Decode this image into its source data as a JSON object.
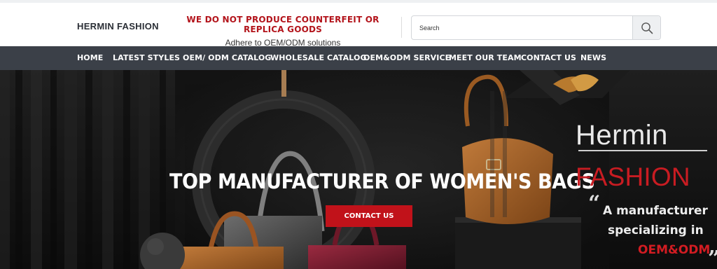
{
  "header": {
    "brand": "HERMIN FASHION",
    "notice_title": "WE DO NOT PRODUCE COUNTERFEIT OR REPLICA GOODS",
    "notice_sub": "Adhere to OEM/ODM solutions",
    "search": {
      "placeholder": "Search",
      "icon": "search-icon"
    }
  },
  "nav": {
    "items": [
      {
        "label": "HOME"
      },
      {
        "label": "LATEST STYLES"
      },
      {
        "label": "OEM/ ODM CATALOG"
      },
      {
        "label": "WHOLESALE CATALOG"
      },
      {
        "label": "OEM&ODM SERVICE"
      },
      {
        "label": "MEET OUR TEAM"
      },
      {
        "label": "CONTACT US"
      },
      {
        "label": "NEWS"
      }
    ]
  },
  "hero": {
    "headline": "TOP MANUFACTURER OF WOMEN'S BAGS",
    "cta_label": "CONTACT US",
    "side_title_1": "Hermin",
    "side_title_2": "FASHION",
    "quote_open": "“",
    "quote_close": "”",
    "tagline_1": "A manufacturer",
    "tagline_2": "specializing in",
    "tagline_accent": "OEM&ODM"
  },
  "colors": {
    "accent_red": "#c1121a",
    "nav_bg": "#3b4048",
    "hero_bg": "#111111"
  }
}
